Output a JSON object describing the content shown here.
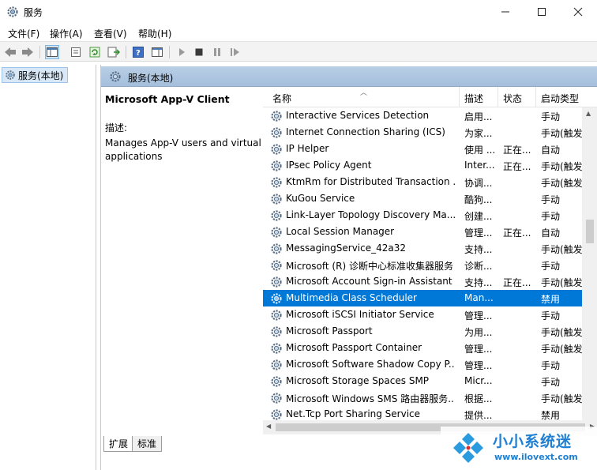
{
  "window": {
    "title": "服务"
  },
  "menu": [
    "文件(F)",
    "操作(A)",
    "查看(V)",
    "帮助(H)"
  ],
  "tree": {
    "item": "服务(本地)"
  },
  "header": {
    "title": "服务(本地)"
  },
  "detail": {
    "service_name": "Microsoft App-V Client",
    "desc_label": "描述:",
    "desc_text": "Manages App-V users and virtual applications"
  },
  "columns": {
    "name": "名称",
    "desc": "描述",
    "status": "状态",
    "start": "启动类型"
  },
  "services": [
    {
      "name": "Interactive Services Detection",
      "desc": "启用...",
      "status": "",
      "start": "手动"
    },
    {
      "name": "Internet Connection Sharing (ICS)",
      "desc": "为家...",
      "status": "",
      "start": "手动(触发"
    },
    {
      "name": "IP Helper",
      "desc": "使用 ...",
      "status": "正在...",
      "start": "自动"
    },
    {
      "name": "IPsec Policy Agent",
      "desc": "Inter...",
      "status": "正在...",
      "start": "手动(触发"
    },
    {
      "name": "KtmRm for Distributed Transaction ...",
      "desc": "协调...",
      "status": "",
      "start": "手动(触发"
    },
    {
      "name": "KuGou Service",
      "desc": "酷狗...",
      "status": "",
      "start": "手动"
    },
    {
      "name": "Link-Layer Topology Discovery Ma...",
      "desc": "创建...",
      "status": "",
      "start": "手动"
    },
    {
      "name": "Local Session Manager",
      "desc": "管理...",
      "status": "正在...",
      "start": "自动"
    },
    {
      "name": "MessagingService_42a32",
      "desc": "支持...",
      "status": "",
      "start": "手动(触发"
    },
    {
      "name": "Microsoft (R) 诊断中心标准收集器服务",
      "desc": "诊断...",
      "status": "",
      "start": "手动"
    },
    {
      "name": "Microsoft Account Sign-in Assistant",
      "desc": "支持...",
      "status": "正在...",
      "start": "手动(触发"
    },
    {
      "name": "Multimedia Class Scheduler",
      "desc": "Man...",
      "status": "",
      "start": "禁用",
      "selected": true
    },
    {
      "name": "Microsoft iSCSI Initiator Service",
      "desc": "管理...",
      "status": "",
      "start": "手动"
    },
    {
      "name": "Microsoft Passport",
      "desc": "为用...",
      "status": "",
      "start": "手动(触发"
    },
    {
      "name": "Microsoft Passport Container",
      "desc": "管理...",
      "status": "",
      "start": "手动(触发"
    },
    {
      "name": "Microsoft Software Shadow Copy P...",
      "desc": "管理...",
      "status": "",
      "start": "手动"
    },
    {
      "name": "Microsoft Storage Spaces SMP",
      "desc": "Micr...",
      "status": "",
      "start": "手动"
    },
    {
      "name": "Microsoft Windows SMS 路由器服务...",
      "desc": "根据...",
      "status": "",
      "start": "手动(触发"
    },
    {
      "name": "Net.Tcp Port Sharing Service",
      "desc": "提供...",
      "status": "",
      "start": "禁用"
    }
  ],
  "tabs": {
    "extended": "扩展",
    "standard": "标准"
  },
  "watermark": {
    "title": "小小系统迷",
    "url": "www.ilovext.com"
  }
}
